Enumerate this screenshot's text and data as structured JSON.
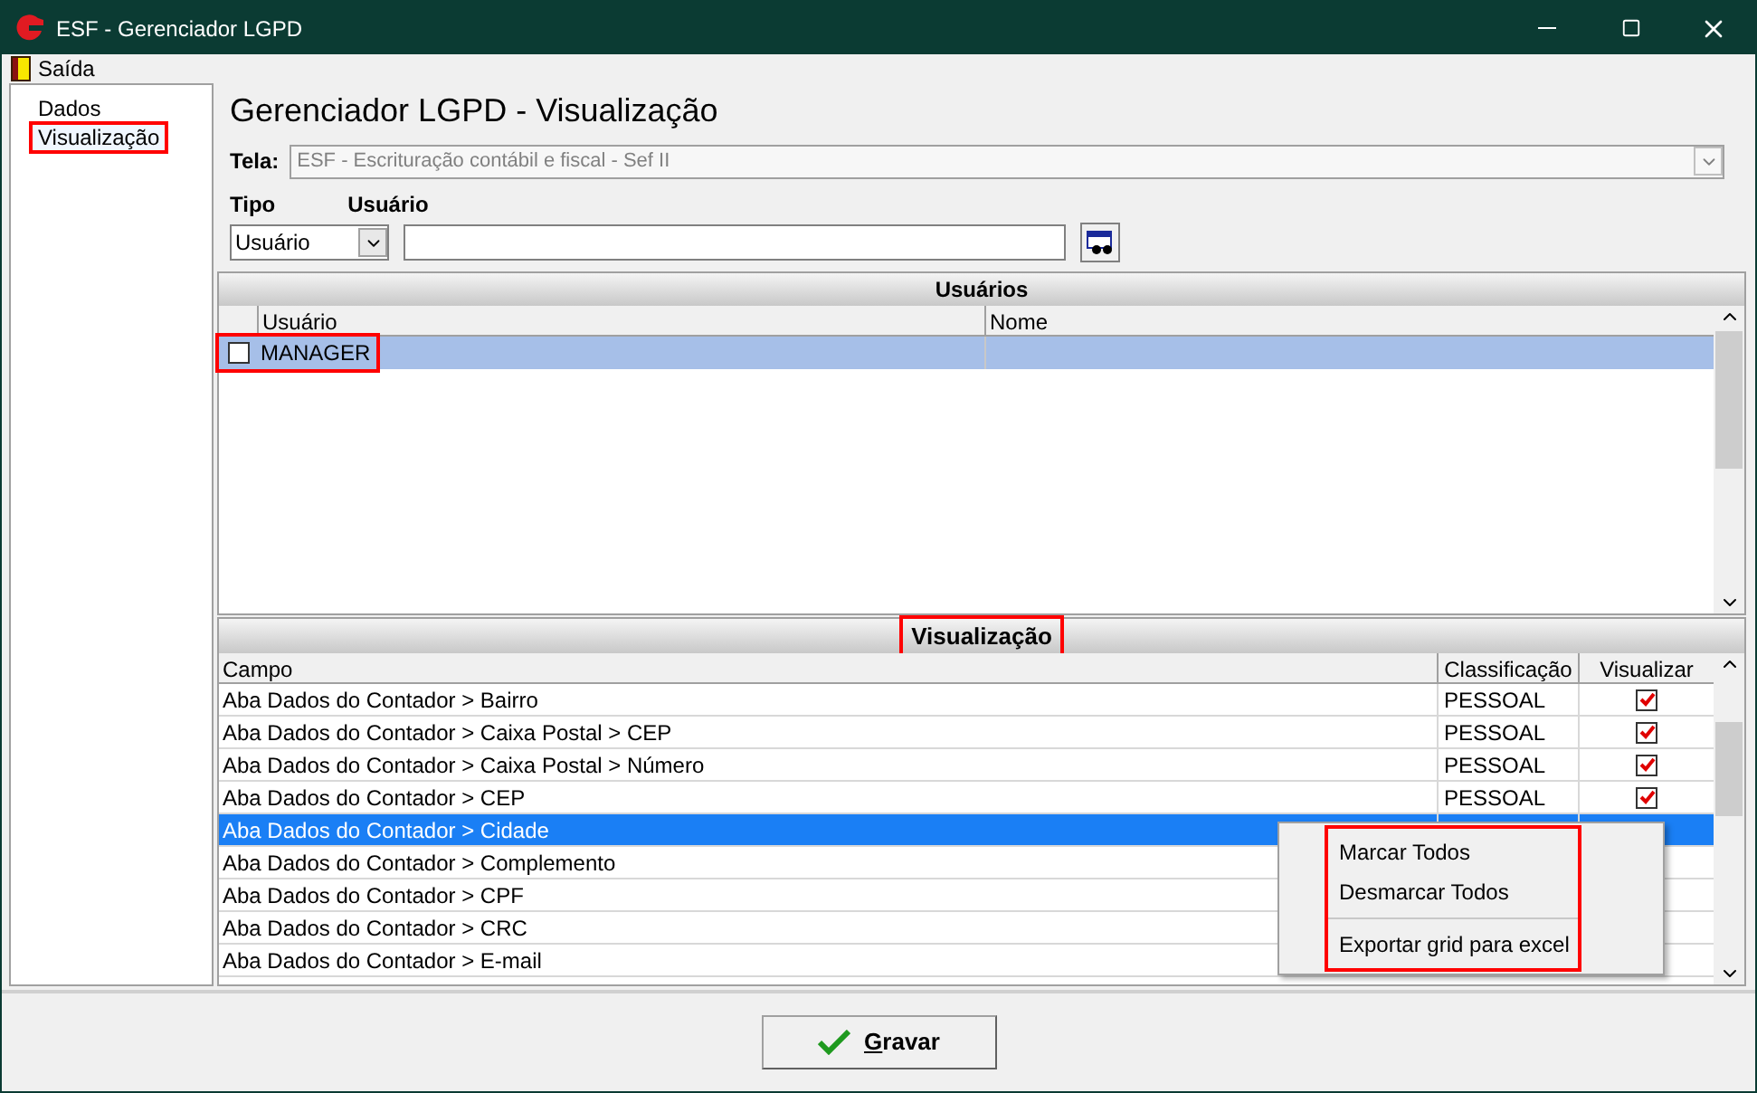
{
  "window": {
    "title": "ESF - Gerenciador LGPD"
  },
  "menu": [
    {
      "label": "Saída"
    }
  ],
  "tree": [
    {
      "label": "Dados",
      "selected": false,
      "highlighted": false
    },
    {
      "label": "Visualização",
      "selected": true,
      "highlighted": true
    }
  ],
  "heading": "Gerenciador LGPD - Visualização",
  "tela": {
    "label": "Tela:",
    "value": "ESF - Escrituração contábil e fiscal - Sef II",
    "disabled": true
  },
  "tipo": {
    "label": "Tipo",
    "value": "Usuário"
  },
  "usuario": {
    "label": "Usuário"
  },
  "users_grid": {
    "title": "Usuários",
    "columns": [
      "Usuário",
      "Nome"
    ],
    "rows": [
      {
        "checked": false,
        "usuario": "MANAGER",
        "selected": true,
        "highlighted": true
      }
    ]
  },
  "fields_grid": {
    "title": "Visualização",
    "title_highlighted": true,
    "columns": [
      "Campo",
      "Classificação",
      "Visualizar"
    ],
    "rows": [
      {
        "campo": "Aba Dados do Contador > Bairro",
        "classificacao": "PESSOAL",
        "visualizar": true,
        "selected": false
      },
      {
        "campo": "Aba Dados do Contador > Caixa Postal > CEP",
        "classificacao": "PESSOAL",
        "visualizar": true,
        "selected": false
      },
      {
        "campo": "Aba Dados do Contador > Caixa Postal > Número",
        "classificacao": "PESSOAL",
        "visualizar": true,
        "selected": false
      },
      {
        "campo": "Aba Dados do Contador > CEP",
        "classificacao": "PESSOAL",
        "visualizar": true,
        "selected": false
      },
      {
        "campo": "Aba Dados do Contador > Cidade",
        "selected": true
      },
      {
        "campo": "Aba Dados do Contador > Complemento",
        "selected": false
      },
      {
        "campo": "Aba Dados do Contador > CPF",
        "selected": false
      },
      {
        "campo": "Aba Dados do Contador > CRC",
        "selected": false
      },
      {
        "campo": "Aba Dados do Contador > E-mail",
        "selected": false
      }
    ]
  },
  "context_menu": {
    "highlighted": true,
    "items": [
      {
        "kind": "item",
        "label": "Marcar Todos"
      },
      {
        "kind": "item",
        "label": "Desmarcar Todos"
      },
      {
        "kind": "separator"
      },
      {
        "kind": "item",
        "label": "Exportar grid para excel"
      }
    ]
  },
  "save_button": {
    "label": "Gravar",
    "underline_first": true
  }
}
